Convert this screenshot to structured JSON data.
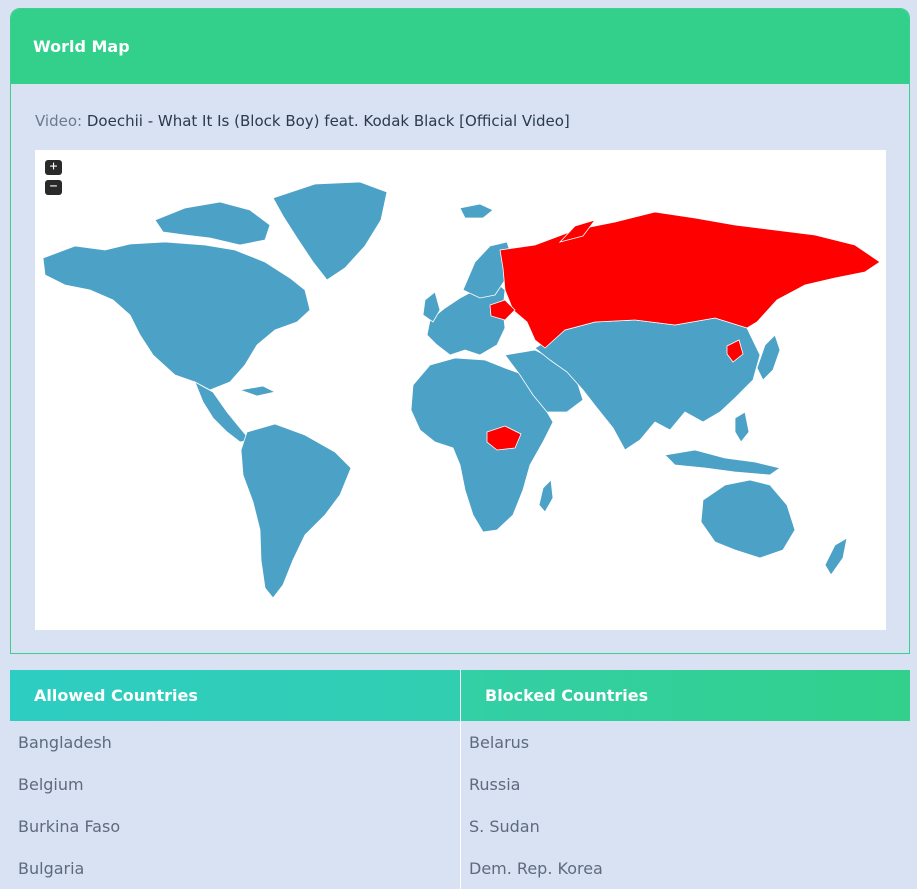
{
  "card": {
    "title": "World Map"
  },
  "video": {
    "label": "Video:",
    "title": "Doechii - What It Is (Block Boy) feat. Kodak Black [Official Video]"
  },
  "map": {
    "zoom_in": "+",
    "zoom_out": "−",
    "land_color": "#4ca1c6",
    "blocked_color": "#ff0000",
    "blocked_regions": [
      "Russia",
      "Belarus",
      "S. Sudan",
      "Dem. Rep. Korea"
    ]
  },
  "allowed": {
    "header": "Allowed Countries",
    "items": [
      "Bangladesh",
      "Belgium",
      "Burkina Faso",
      "Bulgaria"
    ]
  },
  "blocked": {
    "header": "Blocked Countries",
    "items": [
      "Belarus",
      "Russia",
      "S. Sudan",
      "Dem. Rep. Korea"
    ]
  },
  "colors": {
    "header": "#32d08b",
    "accent_border": "#3ccf8e",
    "page_bg": "#d9e2f3"
  }
}
